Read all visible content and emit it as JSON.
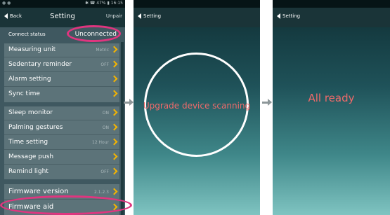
{
  "phone1": {
    "status": {
      "left": "● ●",
      "right": "✱ ☎ 47% ▮ 16:15"
    },
    "header": {
      "back": "Back",
      "title": "Setting",
      "unpair": "Unpair"
    },
    "connect": {
      "label": "Connect status",
      "value": "Unconnected"
    },
    "group1": [
      {
        "label": "Measuring unit",
        "value": "Metric"
      },
      {
        "label": "Sedentary reminder",
        "value": "OFF"
      },
      {
        "label": "Alarm setting",
        "value": ""
      },
      {
        "label": "Sync time",
        "value": ""
      }
    ],
    "group2": [
      {
        "label": "Sleep monitor",
        "value": "ON"
      },
      {
        "label": "Palming gestures",
        "value": "ON"
      },
      {
        "label": "Time setting",
        "value": "12 Hour"
      },
      {
        "label": "Message push",
        "value": ""
      },
      {
        "label": "Remind light",
        "value": "OFF"
      }
    ],
    "group3": [
      {
        "label": "Firmware version",
        "value": "2.1.2.3"
      },
      {
        "label": "Firmware aid",
        "value": ""
      }
    ]
  },
  "phone2": {
    "header": {
      "back": "Setting"
    },
    "scan_text": "Upgrade device scanning"
  },
  "phone3": {
    "header": {
      "back": "Setting"
    },
    "ready_text": "All ready"
  },
  "colors": {
    "highlight": "#e0357f",
    "accent": "#f5b400",
    "message": "#f06a6a"
  }
}
